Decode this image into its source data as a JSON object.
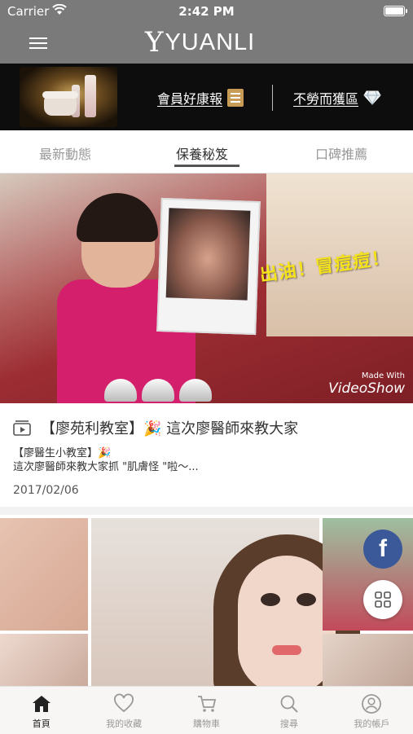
{
  "status_bar": {
    "carrier": "Carrier",
    "time": "2:42 PM"
  },
  "header": {
    "logo_text": "YUANLI"
  },
  "banner": {
    "news_label": "會員好康報",
    "rewards_label": "不勞而獲區"
  },
  "tabs": [
    {
      "label": "最新動態",
      "active": false
    },
    {
      "label": "保養秘笈",
      "active": true
    },
    {
      "label": "口碑推薦",
      "active": false
    }
  ],
  "video": {
    "overlay_text": "出油！冒痘痘！",
    "watermark_small": "Made With",
    "watermark_big": "VideoShow"
  },
  "post": {
    "title": "【廖苑利教室】🎉 這次廖醫師來教大家",
    "excerpt_line1": "【廖醫生小教室】🎉",
    "excerpt_line2": "這次廖醫師來教大家抓 \"肌膚怪 \"啦～...",
    "date": "2017/02/06"
  },
  "fab": {
    "facebook_glyph": "f"
  },
  "tabbar": [
    {
      "label": "首頁",
      "icon": "home-icon",
      "active": true
    },
    {
      "label": "我的收藏",
      "icon": "heart-icon",
      "active": false
    },
    {
      "label": "購物車",
      "icon": "cart-icon",
      "active": false
    },
    {
      "label": "搜尋",
      "icon": "search-icon",
      "active": false
    },
    {
      "label": "我的帳戶",
      "icon": "account-icon",
      "active": false
    }
  ],
  "colors": {
    "header_bg": "#7a7a7a",
    "banner_bg": "#0d0d0d",
    "facebook": "#3b5998",
    "overlay_text": "#f5e21b"
  }
}
